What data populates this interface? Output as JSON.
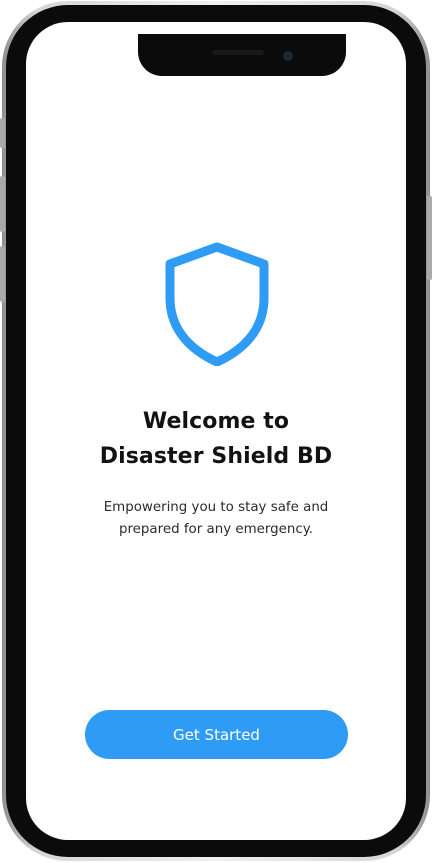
{
  "colors": {
    "accent": "#2e9bf4",
    "title_text": "#121212",
    "body_text": "#2b2b2b",
    "screen_bg": "#ffffff"
  },
  "welcome": {
    "logo_icon": "shield-icon",
    "title_line1": "Welcome to",
    "title_line2": "Disaster Shield BD",
    "subtitle_line1": "Empowering you to stay safe and",
    "subtitle_line2": "prepared for any emergency."
  },
  "actions": {
    "get_started_label": "Get Started"
  }
}
